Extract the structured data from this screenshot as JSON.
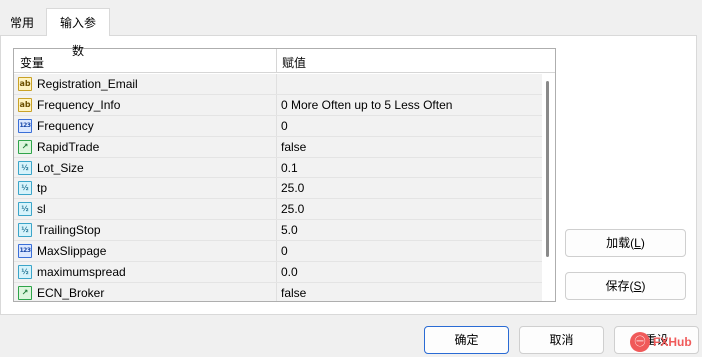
{
  "tabs": [
    {
      "label": "常用",
      "active": false
    },
    {
      "label": "输入参数",
      "active": true
    }
  ],
  "grid": {
    "headers": {
      "variable": "变量",
      "value": "赋值"
    },
    "rows": [
      {
        "type": "string",
        "icon": "ab",
        "name": "Registration_Email",
        "value": ""
      },
      {
        "type": "string",
        "icon": "ab",
        "name": "Frequency_Info",
        "value": "0 More Often up to 5 Less Often"
      },
      {
        "type": "int",
        "icon": "123",
        "name": "Frequency",
        "value": "0"
      },
      {
        "type": "bool",
        "icon": "~",
        "name": "RapidTrade",
        "value": "false"
      },
      {
        "type": "double",
        "icon": "v2",
        "name": "Lot_Size",
        "value": "0.1"
      },
      {
        "type": "double",
        "icon": "v2",
        "name": "tp",
        "value": "25.0"
      },
      {
        "type": "double",
        "icon": "v2",
        "name": "sl",
        "value": "25.0"
      },
      {
        "type": "double",
        "icon": "v2",
        "name": "TrailingStop",
        "value": "5.0"
      },
      {
        "type": "int",
        "icon": "123",
        "name": "MaxSlippage",
        "value": "0"
      },
      {
        "type": "double",
        "icon": "v2",
        "name": "maximumspread",
        "value": "0.0"
      },
      {
        "type": "bool",
        "icon": "~",
        "name": "ECN_Broker",
        "value": "false"
      }
    ]
  },
  "side_buttons": {
    "load_label": "加载(",
    "load_key": "L",
    "load_end": ")",
    "save_label": "保存(",
    "save_key": "S",
    "save_end": ")"
  },
  "footer": {
    "ok_label": "确定",
    "cancel_label": "取消",
    "reset_label": "重设"
  },
  "watermark": {
    "logo": "㊀",
    "text": "FXHub"
  }
}
